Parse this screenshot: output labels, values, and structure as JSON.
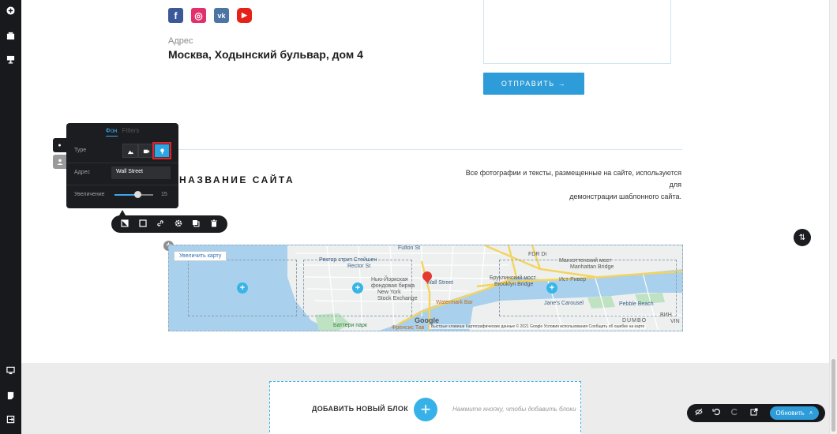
{
  "left_toolbar": {
    "top_icons": [
      "add-icon",
      "layers-icon",
      "desktop-icon"
    ],
    "bottom_icons": [
      "monitor-icon",
      "page-icon",
      "exit-icon"
    ]
  },
  "contacts": {
    "address_label": "Адрес",
    "address_value": "Москва, Ходынский бульвар, дом 4"
  },
  "form": {
    "send_label": "ОТПРАВИТЬ →"
  },
  "footer": {
    "site_name": "НАЗВАНИЕ САЙТА",
    "rights_line1": "Все фотографии и тексты, размещенные на сайте, используются для",
    "rights_line2": "демонстрации шаблонного сайта."
  },
  "panel": {
    "tab_active": "Фон",
    "tab_inactive": "Filters",
    "type_label": "Type",
    "address_label": "Адрес",
    "address_value": "Wall Street",
    "zoom_label": "Увеличение",
    "zoom_value": "15",
    "zoom_fraction": 0.6
  },
  "map": {
    "zoom_link": "Увеличить карту",
    "labels": {
      "fulton": "Fulton St",
      "rector": "Ректор стрит Стейшен",
      "rector_en": "Rector St",
      "nyse": "Нью-Йоркская",
      "nyse2": "фондовая биржа",
      "nyse_en": "New York",
      "nyse_en2": "Stock Exchange",
      "wallst": "Wall Street",
      "waterbar": "Watermark Bar",
      "battery": "Баттери парк",
      "francis": "Френсис Тав",
      "fdr": "FDR Dr",
      "manhattan_bridge": "Манхэттенский мост",
      "manhattan_bridge_en": "Manhattan Bridge",
      "brooklyn_bridge": "Бруклинский мост",
      "brooklyn_bridge_en": "Brooklyn Bridge",
      "east_river": "Ист-Ривер",
      "janes": "Jane's Carousel",
      "pebble": "Pebble Beach",
      "dumbo": "DUMBO",
      "vin": "ВИН",
      "vin2": "VIN"
    },
    "google": "Google",
    "attribution": "Быстрые клавиши   Картографические данные © 2021 Google   Условия использования   Сообщить об ошибке на карте"
  },
  "add_block": {
    "label": "ДОБАВИТЬ НОВЫЙ БЛОК",
    "hint": "Нажмите кнопку, чтобы добавить блоки"
  },
  "bottom_toolbar": {
    "update_label": "Обновить"
  }
}
